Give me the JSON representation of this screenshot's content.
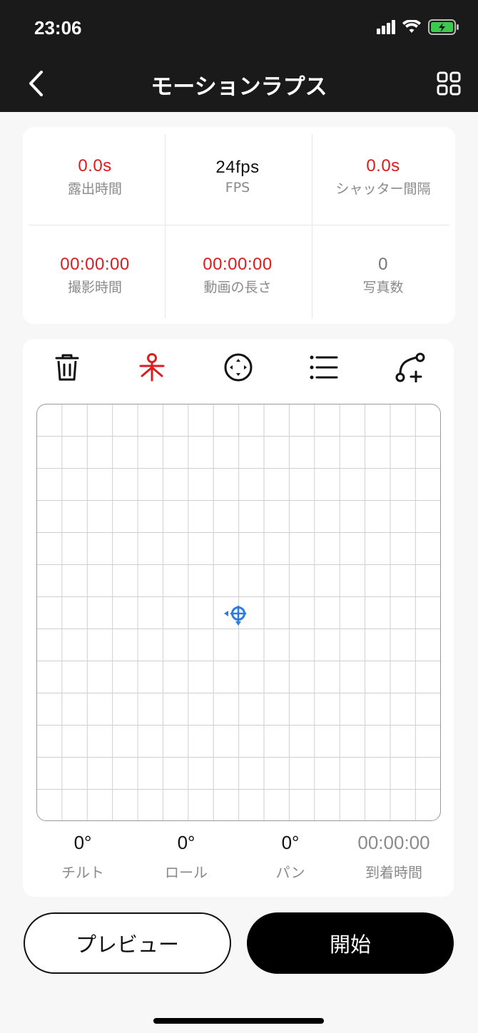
{
  "status_bar": {
    "time": "23:06"
  },
  "nav": {
    "title": "モーションラプス"
  },
  "stats": [
    {
      "value": "0.0s",
      "label": "露出時間",
      "color": "#d81e1e"
    },
    {
      "value": "24fps",
      "label": "FPS",
      "color": "#111111"
    },
    {
      "value": "0.0s",
      "label": "シャッター間隔",
      "color": "#d81e1e"
    },
    {
      "value": "00:00:00",
      "label": "撮影時間",
      "color": "#d81e1e"
    },
    {
      "value": "00:00:00",
      "label": "動画の長さ",
      "color": "#d81e1e"
    },
    {
      "value": "0",
      "label": "写真数",
      "color": "#777777"
    }
  ],
  "toolbar": {
    "icons": [
      "trash-icon",
      "tripod-icon",
      "joystick-icon",
      "list-icon",
      "path-add-icon"
    ],
    "active_color": "#d81e1e"
  },
  "angles": [
    {
      "value": "0°",
      "label": "チルト"
    },
    {
      "value": "0°",
      "label": "ロール"
    },
    {
      "value": "0°",
      "label": "パン"
    },
    {
      "value": "00:00:00",
      "label": "到着時間"
    }
  ],
  "buttons": {
    "preview": "プレビュー",
    "start": "開始"
  },
  "accent_color": "#2e7be0"
}
